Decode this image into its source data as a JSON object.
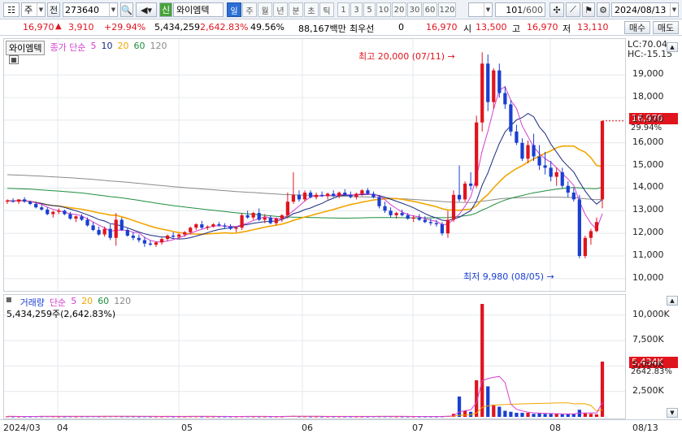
{
  "toolbar": {
    "market": "주",
    "prev": "전",
    "code": "273640",
    "shin": "신",
    "name": "와이엠텍",
    "periods": [
      "일",
      "주",
      "월",
      "년",
      "분",
      "초",
      "틱"
    ],
    "selected_period": "일",
    "nums": [
      "1",
      "3",
      "5",
      "10",
      "20",
      "30",
      "60",
      "120"
    ],
    "count": "101",
    "count_total": "/600",
    "date": "2024/08/13"
  },
  "info": {
    "price": "16,970",
    "change": "3,910",
    "change_pct": "+29.94%",
    "volume": "5,434,259",
    "vol_pct": "2,642.83%",
    "turnover": "49.56%",
    "amount": "88,167백만",
    "prior_label": "최우선",
    "prior_val": "0",
    "cur_price": "16,970",
    "open_label": "시",
    "open": "13,500",
    "high_label": "고",
    "high": "16,970",
    "low_label": "저",
    "low": "13,110",
    "buy": "매수",
    "sell": "매도"
  },
  "price_pane": {
    "title": "와이엠텍",
    "legend_label": "종가 단순",
    "ma": [
      "5",
      "10",
      "20",
      "60",
      "120"
    ],
    "lc": "LC:70.04",
    "hc": "HC:-15.15",
    "high_note": "최고 20,000 (07/11)",
    "low_note": "최저 9,980 (08/05)",
    "tag_price": "16,970",
    "tag_pct": "29.94%"
  },
  "volume_pane": {
    "title": "거래량",
    "legend_label": "단순",
    "ma": [
      "5",
      "20",
      "60",
      "120"
    ],
    "current": "5,434,259주(2,642.83%)",
    "tag_vol": "5,434K",
    "tag_pct": "2642.83%"
  },
  "colors": {
    "up": "#e0141e",
    "down": "#1a3fd0",
    "ma5": "#d43fd0",
    "ma10": "#1b2a80",
    "ma20": "#f2a600",
    "ma60": "#1e8e3e",
    "ma120": "#8a8a8a"
  },
  "chart_data": {
    "type": "candlestick",
    "x_labels": [
      "2024/03",
      "04",
      "05",
      "06",
      "07",
      "08",
      "08/13"
    ],
    "price_ticks": [
      10000,
      11000,
      12000,
      13000,
      14000,
      15000,
      16000,
      17000,
      18000,
      19000
    ],
    "price_ylim": [
      9600,
      20300
    ],
    "volume_ticks": [
      2500000,
      5000000,
      7500000,
      10000000
    ],
    "volume_ylim": [
      0,
      11500000
    ],
    "candles": [
      [
        13400,
        13500,
        13300,
        13450
      ],
      [
        13450,
        13550,
        13350,
        13400
      ],
      [
        13400,
        13500,
        13300,
        13500
      ],
      [
        13500,
        13600,
        13350,
        13400
      ],
      [
        13400,
        13450,
        13250,
        13300
      ],
      [
        13300,
        13400,
        13100,
        13150
      ],
      [
        13150,
        13250,
        13000,
        13050
      ],
      [
        13050,
        13150,
        12800,
        12850
      ],
      [
        12850,
        13000,
        12700,
        12950
      ],
      [
        12950,
        13100,
        12850,
        13000
      ],
      [
        13000,
        13050,
        12800,
        12850
      ],
      [
        12850,
        12950,
        12600,
        12650
      ],
      [
        12650,
        12800,
        12500,
        12750
      ],
      [
        12750,
        12850,
        12550,
        12600
      ],
      [
        12600,
        12700,
        12300,
        12350
      ],
      [
        12350,
        12500,
        12100,
        12150
      ],
      [
        12150,
        12300,
        11900,
        11950
      ],
      [
        11950,
        12300,
        11850,
        12200
      ],
      [
        12200,
        12400,
        11700,
        11800
      ],
      [
        11800,
        12900,
        11450,
        12600
      ],
      [
        12600,
        12700,
        12100,
        12150
      ],
      [
        12150,
        12250,
        11850,
        11900
      ],
      [
        11900,
        12050,
        11700,
        11800
      ],
      [
        11800,
        11950,
        11600,
        11700
      ],
      [
        11700,
        11850,
        11400,
        11550
      ],
      [
        11550,
        11700,
        11450,
        11500
      ],
      [
        11500,
        11650,
        11400,
        11600
      ],
      [
        11600,
        11800,
        11500,
        11750
      ],
      [
        11750,
        11950,
        11650,
        11900
      ],
      [
        11900,
        12050,
        11800,
        11850
      ],
      [
        11850,
        12000,
        11750,
        11950
      ],
      [
        11950,
        12100,
        11850,
        12050
      ],
      [
        12050,
        12300,
        11950,
        12250
      ],
      [
        12250,
        12450,
        12150,
        12400
      ],
      [
        12400,
        12550,
        12200,
        12250
      ],
      [
        12250,
        12350,
        12150,
        12300
      ],
      [
        12300,
        12450,
        12250,
        12400
      ],
      [
        12400,
        12500,
        12300,
        12350
      ],
      [
        12350,
        12450,
        12200,
        12300
      ],
      [
        12300,
        12400,
        12150,
        12200
      ],
      [
        12200,
        12300,
        12050,
        12250
      ],
      [
        12250,
        12900,
        12150,
        12800
      ],
      [
        12800,
        13000,
        12650,
        12700
      ],
      [
        12700,
        12950,
        12600,
        12900
      ],
      [
        12900,
        13100,
        12550,
        12600
      ],
      [
        12600,
        12850,
        12450,
        12700
      ],
      [
        12700,
        12800,
        12400,
        12450
      ],
      [
        12450,
        12700,
        12350,
        12650
      ],
      [
        12650,
        12850,
        12500,
        12800
      ],
      [
        12800,
        13800,
        12650,
        13400
      ],
      [
        13400,
        14700,
        13300,
        13700
      ],
      [
        13700,
        13900,
        13400,
        13500
      ],
      [
        13500,
        13900,
        13400,
        13800
      ],
      [
        13800,
        13900,
        13550,
        13600
      ],
      [
        13600,
        13800,
        13500,
        13700
      ],
      [
        13700,
        13850,
        13600,
        13650
      ],
      [
        13650,
        13800,
        13500,
        13750
      ],
      [
        13750,
        13900,
        13600,
        13650
      ],
      [
        13650,
        13850,
        13550,
        13800
      ],
      [
        13800,
        13950,
        13650,
        13700
      ],
      [
        13700,
        13850,
        13550,
        13600
      ],
      [
        13600,
        13800,
        13500,
        13750
      ],
      [
        13750,
        13950,
        13650,
        13900
      ],
      [
        13900,
        14000,
        13700,
        13750
      ],
      [
        13750,
        13850,
        13550,
        13600
      ],
      [
        13600,
        13700,
        13100,
        13200
      ],
      [
        13200,
        13400,
        12900,
        13000
      ],
      [
        13000,
        13150,
        12700,
        12800
      ],
      [
        12800,
        12950,
        12650,
        12900
      ],
      [
        12900,
        13050,
        12750,
        12800
      ],
      [
        12800,
        12900,
        12600,
        12650
      ],
      [
        12650,
        12800,
        12500,
        12700
      ],
      [
        12700,
        12850,
        12550,
        12600
      ],
      [
        12600,
        12750,
        12450,
        12500
      ],
      [
        12500,
        12650,
        12350,
        12450
      ],
      [
        12450,
        12600,
        12300,
        12400
      ],
      [
        12400,
        12500,
        11900,
        12000
      ],
      [
        12000,
        13000,
        11800,
        12600
      ],
      [
        12600,
        13900,
        12500,
        13700
      ],
      [
        13700,
        15000,
        13400,
        13500
      ],
      [
        13500,
        14300,
        13400,
        14200
      ],
      [
        14200,
        14700,
        13900,
        14100
      ],
      [
        14100,
        17200,
        14000,
        16900
      ],
      [
        16900,
        20000,
        16500,
        19500
      ],
      [
        19500,
        19900,
        17400,
        17800
      ],
      [
        17800,
        19300,
        17500,
        19200
      ],
      [
        19200,
        19500,
        18000,
        18200
      ],
      [
        18200,
        18500,
        17500,
        17700
      ],
      [
        17700,
        17900,
        16300,
        16500
      ],
      [
        16500,
        16800,
        15900,
        16000
      ],
      [
        16000,
        16200,
        15200,
        15300
      ],
      [
        15300,
        16100,
        15100,
        15900
      ],
      [
        15900,
        16400,
        15200,
        15400
      ],
      [
        15400,
        15900,
        14800,
        15000
      ],
      [
        15000,
        15600,
        14600,
        14900
      ],
      [
        14900,
        15200,
        14300,
        14500
      ],
      [
        14500,
        14900,
        14100,
        14700
      ],
      [
        14700,
        14900,
        14000,
        14100
      ],
      [
        14100,
        14300,
        13600,
        13800
      ],
      [
        13800,
        14000,
        13400,
        13500
      ],
      [
        13500,
        13700,
        10900,
        11000
      ],
      [
        11000,
        11900,
        10900,
        11800
      ],
      [
        11800,
        12200,
        11500,
        12100
      ],
      [
        12100,
        12700,
        12050,
        12500
      ],
      [
        13500,
        16970,
        13110,
        16970
      ]
    ],
    "volumes": [
      0.05,
      0.04,
      0.04,
      0.04,
      0.04,
      0.05,
      0.05,
      0.06,
      0.05,
      0.04,
      0.04,
      0.05,
      0.04,
      0.05,
      0.05,
      0.06,
      0.05,
      0.05,
      0.06,
      0.06,
      0.05,
      0.05,
      0.05,
      0.04,
      0.05,
      0.04,
      0.04,
      0.04,
      0.05,
      0.04,
      0.04,
      0.04,
      0.05,
      0.05,
      0.04,
      0.04,
      0.04,
      0.04,
      0.04,
      0.04,
      0.04,
      0.05,
      0.05,
      0.04,
      0.04,
      0.04,
      0.04,
      0.04,
      0.04,
      0.08,
      0.1,
      0.05,
      0.05,
      0.04,
      0.04,
      0.04,
      0.04,
      0.04,
      0.04,
      0.04,
      0.04,
      0.04,
      0.04,
      0.04,
      0.05,
      0.05,
      0.05,
      0.05,
      0.04,
      0.04,
      0.04,
      0.04,
      0.04,
      0.04,
      0.04,
      0.04,
      0.05,
      0.09,
      0.3,
      2.0,
      0.6,
      0.5,
      3.6,
      11.1,
      3.0,
      1.2,
      1.0,
      0.6,
      0.5,
      0.4,
      0.4,
      0.4,
      0.3,
      0.35,
      0.3,
      0.3,
      0.3,
      0.25,
      0.3,
      0.3,
      0.7,
      0.35,
      0.3,
      0.25,
      5.43
    ],
    "volume_unit": 1000000
  }
}
